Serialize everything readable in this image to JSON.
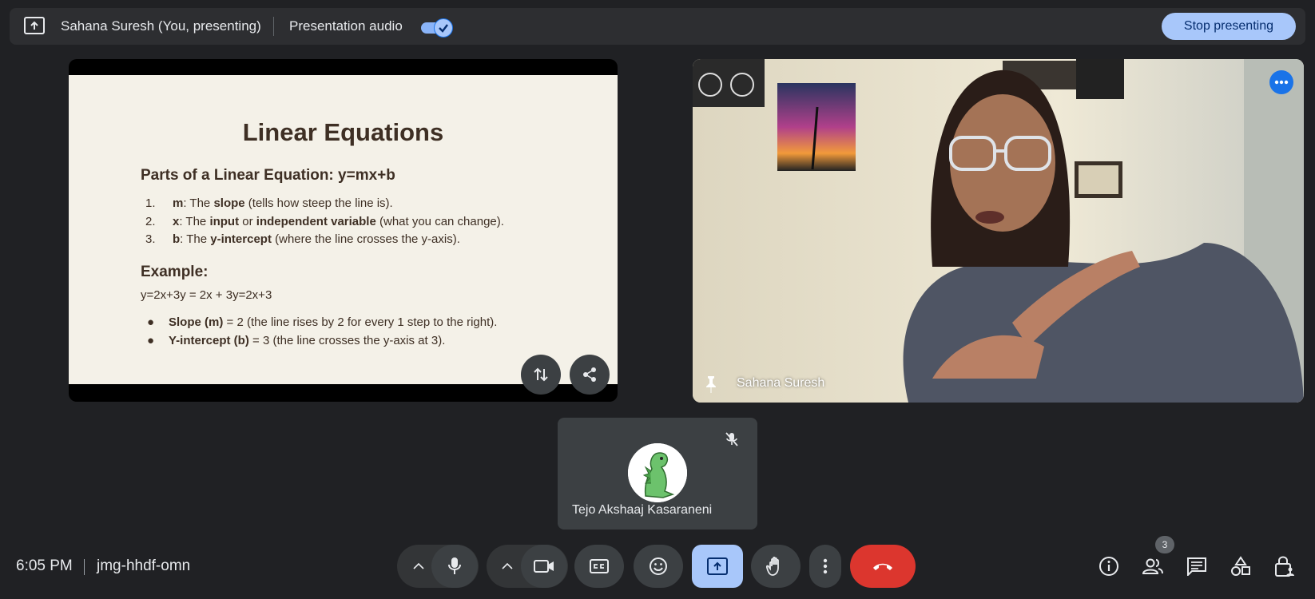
{
  "topbar": {
    "presenter_label": "Sahana Suresh (You, presenting)",
    "audio_label": "Presentation audio",
    "audio_enabled": true,
    "stop_button": "Stop presenting"
  },
  "slide": {
    "title": "Linear Equations",
    "subtitle": "Parts of a Linear Equation: y=mx+b",
    "items": [
      {
        "num": "1.",
        "term": "m",
        "pre": ": The ",
        "bold": "slope",
        "post": " (tells how steep the line is)."
      },
      {
        "num": "2.",
        "term": "x",
        "pre": ": The ",
        "bold": "input",
        "mid": " or ",
        "bold2": "independent variable",
        "post": " (what you can change)."
      },
      {
        "num": "3.",
        "term": "b",
        "pre": ": The ",
        "bold": "y-intercept",
        "post": " (where the line crosses the y-axis)."
      }
    ],
    "example_heading": "Example:",
    "equation": "y=2x+3y = 2x + 3y=2x+3",
    "bullets": [
      {
        "bold": "Slope (m)",
        "text": " = 2 (the line rises by 2 for every 1 step to the right)."
      },
      {
        "bold": "Y-intercept (b)",
        "text": " = 3 (the line crosses the y-axis at 3)."
      }
    ]
  },
  "camera": {
    "name": "Sahana Suresh"
  },
  "participant": {
    "name": "Tejo Akshaaj Kasaraneni"
  },
  "bottombar": {
    "time": "6:05 PM",
    "meeting_code": "jmg-hhdf-omn",
    "people_count": "3"
  },
  "colors": {
    "background": "#202124",
    "accent": "#a8c7fa",
    "end_call": "#dc362e"
  }
}
